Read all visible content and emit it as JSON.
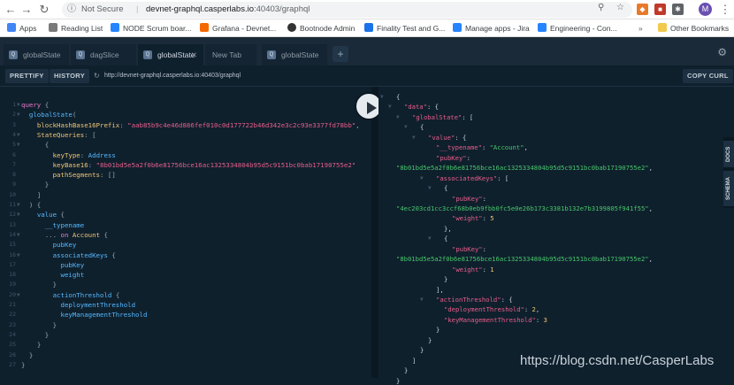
{
  "browser": {
    "security_label": "Not Secure",
    "url_host": "devnet-graphql.casperlabs.io",
    "url_path": ":40403/graphql",
    "avatar_letter": "M"
  },
  "bookmarks": [
    "Apps",
    "Reading List",
    "NODE Scrum boar...",
    "Grafana - Devnet...",
    "Bootnode Admin",
    "Finality Test and G...",
    "Manage apps - Jira",
    "Engineering - Con...",
    "Other Bookmarks"
  ],
  "tabs": [
    {
      "label": "globalState",
      "active": false
    },
    {
      "label": "dagSlice",
      "active": false
    },
    {
      "label": "globalState",
      "active": true
    },
    {
      "label": "New Tab",
      "active": false
    },
    {
      "label": "globalState",
      "active": false
    }
  ],
  "toolbar": {
    "prettify": "PRETTIFY",
    "history": "HISTORY",
    "endpoint": "http://devnet-graphql.casperlabs.io:40403/graphql",
    "copy_curl": "COPY CURL"
  },
  "query_lines": [
    {
      "n": "1",
      "fold": "▼",
      "html": "<span class='k'>query</span> <span class='p'>{</span>"
    },
    {
      "n": "2",
      "fold": "▼",
      "html": "  <span class='f'>globalState</span><span class='p'>(</span>"
    },
    {
      "n": "3",
      "fold": "",
      "html": "    <span class='t'>blockHashBase16Prefix</span><span class='p'>:</span> <span class='s'>\"aab85b9c4e46d886fef010c0d177722b46d342e3c2c93e3377fd78bb\"</span><span class='p'>,</span>"
    },
    {
      "n": "4",
      "fold": "▼",
      "html": "    <span class='t'>StateQueries</span><span class='p'>: [</span>"
    },
    {
      "n": "5",
      "fold": "▼",
      "html": "      <span class='p'>{</span>"
    },
    {
      "n": "6",
      "fold": "",
      "html": "        <span class='t'>keyType</span><span class='p'>:</span> <span class='f'>Address</span>"
    },
    {
      "n": "7",
      "fold": "",
      "html": "        <span class='t'>keyBase16</span><span class='p'>:</span> <span class='s'>\"8b01bd5e5a2f0b6e81756bce16ac1325334804b95d5c9151bc0bab17190755e2\"</span>"
    },
    {
      "n": "8",
      "fold": "",
      "html": "        <span class='t'>pathSegments</span><span class='p'>: []</span>"
    },
    {
      "n": "9",
      "fold": "",
      "html": "      <span class='p'>}</span>"
    },
    {
      "n": "10",
      "fold": "",
      "html": "    <span class='p'>]</span>"
    },
    {
      "n": "11",
      "fold": "▼",
      "html": "  <span class='p'>) {</span>"
    },
    {
      "n": "12",
      "fold": "▼",
      "html": "    <span class='f'>value</span> <span class='p'>{</span>"
    },
    {
      "n": "13",
      "fold": "",
      "html": "      <span class='f'>__typename</span>"
    },
    {
      "n": "14",
      "fold": "▼",
      "html": "      <span class='p'>...</span> <span class='k'>on</span> <span class='t'>Account</span> <span class='p'>{</span>"
    },
    {
      "n": "15",
      "fold": "",
      "html": "        <span class='f'>pubKey</span>"
    },
    {
      "n": "16",
      "fold": "▼",
      "html": "        <span class='f'>associatedKeys</span> <span class='p'>{</span>"
    },
    {
      "n": "17",
      "fold": "",
      "html": "          <span class='f'>pubKey</span>"
    },
    {
      "n": "18",
      "fold": "",
      "html": "          <span class='f'>weight</span>"
    },
    {
      "n": "19",
      "fold": "",
      "html": "        <span class='p'>}</span>"
    },
    {
      "n": "20",
      "fold": "▼",
      "html": "        <span class='f'>actionThreshold</span> <span class='p'>{</span>"
    },
    {
      "n": "21",
      "fold": "",
      "html": "          <span class='f'>deploymentThreshold</span>"
    },
    {
      "n": "22",
      "fold": "",
      "html": "          <span class='f'>keyManagementThreshold</span>"
    },
    {
      "n": "23",
      "fold": "",
      "html": "        <span class='p'>}</span>"
    },
    {
      "n": "24",
      "fold": "",
      "html": "      <span class='p'>}</span>"
    },
    {
      "n": "25",
      "fold": "",
      "html": "    <span class='p'>}</span>"
    },
    {
      "n": "26",
      "fold": "",
      "html": "  <span class='p'>}</span>"
    },
    {
      "n": "27",
      "fold": "",
      "html": "<span class='p'>}</span>"
    }
  ],
  "result_lines": [
    {
      "i": 0,
      "fold": "▼",
      "html": "{"
    },
    {
      "i": 1,
      "fold": "▼",
      "html": "<span class='rk'>\"data\"</span>: {"
    },
    {
      "i": 2,
      "fold": "▼",
      "html": "<span class='rk'>\"globalState\"</span>: ["
    },
    {
      "i": 3,
      "fold": "▼",
      "html": "{"
    },
    {
      "i": 4,
      "fold": "▼",
      "html": "<span class='rk'>\"value\"</span>: {"
    },
    {
      "i": 5,
      "fold": "",
      "html": "<span class='rk'>\"__typename\"</span>: <span class='rv'>\"Account\"</span>,"
    },
    {
      "i": 5,
      "fold": "",
      "html": "<span class='rk'>\"pubKey\"</span>:"
    },
    {
      "i": 0,
      "fold": "",
      "html": "<span class='rv'>\"8b01bd5e5a2f0b6e81756bce16ac1325334804b95d5c9151bc0bab17190755e2\"</span>,"
    },
    {
      "i": 5,
      "fold": "▼",
      "html": "<span class='rk'>\"associatedKeys\"</span>: ["
    },
    {
      "i": 6,
      "fold": "▼",
      "html": "{"
    },
    {
      "i": 7,
      "fold": "",
      "html": "<span class='rk'>\"pubKey\"</span>:"
    },
    {
      "i": 0,
      "fold": "",
      "html": "<span class='rv'>\"4ec203cd1cc3ccf68b0eb9fbb0fc5e0e26b173c3381b132e7b3199805f941f55\"</span>,"
    },
    {
      "i": 7,
      "fold": "",
      "html": "<span class='rk'>\"weight\"</span>: <span class='rn'>5</span>"
    },
    {
      "i": 6,
      "fold": "",
      "html": "},"
    },
    {
      "i": 6,
      "fold": "▼",
      "html": "{"
    },
    {
      "i": 7,
      "fold": "",
      "html": "<span class='rk'>\"pubKey\"</span>:"
    },
    {
      "i": 0,
      "fold": "",
      "html": "<span class='rv'>\"8b01bd5e5a2f0b6e81756bce16ac1325334804b95d5c9151bc0bab17190755e2\"</span>,"
    },
    {
      "i": 7,
      "fold": "",
      "html": "<span class='rk'>\"weight\"</span>: <span class='rn'>1</span>"
    },
    {
      "i": 6,
      "fold": "",
      "html": "}"
    },
    {
      "i": 5,
      "fold": "",
      "html": "],"
    },
    {
      "i": 5,
      "fold": "▼",
      "html": "<span class='rk'>\"actionThreshold\"</span>: {"
    },
    {
      "i": 6,
      "fold": "",
      "html": "<span class='rk'>\"deploymentThreshold\"</span>: <span class='rn'>2</span>,"
    },
    {
      "i": 6,
      "fold": "",
      "html": "<span class='rk'>\"keyManagementThreshold\"</span>: <span class='rn'>3</span>"
    },
    {
      "i": 5,
      "fold": "",
      "html": "}"
    },
    {
      "i": 4,
      "fold": "",
      "html": "}"
    },
    {
      "i": 3,
      "fold": "",
      "html": "}"
    },
    {
      "i": 2,
      "fold": "",
      "html": "]"
    },
    {
      "i": 1,
      "fold": "",
      "html": "}"
    },
    {
      "i": 0,
      "fold": "",
      "html": "}"
    }
  ],
  "side_tabs": [
    "DOCS",
    "SCHEMA"
  ],
  "watermark": "https://blog.csdn.net/CasperLabs"
}
